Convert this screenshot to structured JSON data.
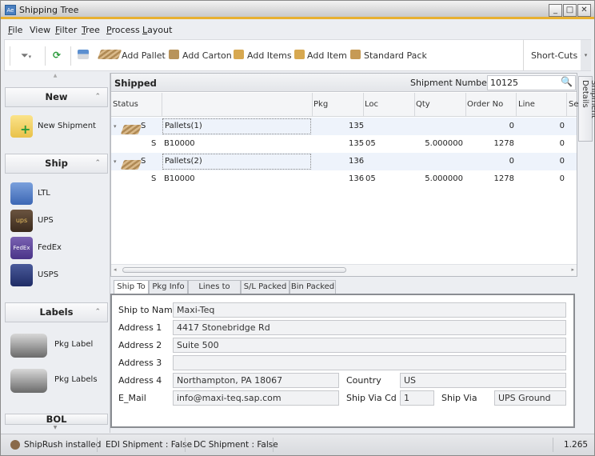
{
  "window": {
    "title": "Shipping Tree",
    "app_icon": "Ae"
  },
  "menu": [
    {
      "label": "File",
      "u": "F"
    },
    {
      "label": "View",
      "u": ""
    },
    {
      "label": "Filter",
      "u": "F"
    },
    {
      "label": "Tree",
      "u": "T"
    },
    {
      "label": "Process",
      "u": "P"
    },
    {
      "label": "Layout",
      "u": "L"
    }
  ],
  "toolbar": {
    "add_pallet": "Add Pallet",
    "add_carton": "Add Carton",
    "add_items": "Add Items",
    "add_item": "Add Item",
    "standard_pack": "Standard Pack",
    "shortcuts": "Short-Cuts"
  },
  "sidebar": {
    "groups": {
      "new": "New",
      "ship": "Ship",
      "labels": "Labels",
      "bol": "BOL"
    },
    "new_items": [
      {
        "label": "New Shipment",
        "icon": "new-shipment-icon"
      }
    ],
    "ship_items": [
      {
        "label": "LTL",
        "icon": "truck-icon"
      },
      {
        "label": "UPS",
        "icon": "ups-icon"
      },
      {
        "label": "FedEx",
        "icon": "fedex-icon"
      },
      {
        "label": "USPS",
        "icon": "usps-icon"
      }
    ],
    "label_items": [
      {
        "label": "Pkg Label",
        "icon": "printer-icon"
      },
      {
        "label": "Pkg Labels",
        "icon": "printer-icon"
      }
    ]
  },
  "grid": {
    "title": "Shipped",
    "shipment_number_label": "Shipment Number:",
    "shipment_number": "10125",
    "columns": [
      "Status",
      "",
      "Pkg",
      "Loc",
      "Qty",
      "Order No",
      "Line",
      "Se"
    ],
    "rows": [
      {
        "status": "S",
        "name": "Pallets(1)",
        "pkg": "135",
        "loc": "",
        "qty": "",
        "order": "0",
        "line": "0",
        "parent": true
      },
      {
        "status": "S",
        "name": "B10000",
        "pkg": "135",
        "loc": "05",
        "qty": "5.000000",
        "order": "1278",
        "line": "0",
        "parent": false
      },
      {
        "status": "S",
        "name": "Pallets(2)",
        "pkg": "136",
        "loc": "",
        "qty": "",
        "order": "0",
        "line": "0",
        "parent": true
      },
      {
        "status": "S",
        "name": "B10000",
        "pkg": "136",
        "loc": "05",
        "qty": "5.000000",
        "order": "1278",
        "line": "0",
        "parent": false
      }
    ]
  },
  "side_tab": "Shipment Details",
  "tabs": [
    "Ship To",
    "Pkg Info",
    "Lines to Pack",
    "S/L Packed",
    "Bin Packed"
  ],
  "ship_to": {
    "name_label": "Ship to Name",
    "name": "Maxi-Teq",
    "addr1_label": "Address 1",
    "addr1": "4417 Stonebridge Rd",
    "addr2_label": "Address 2",
    "addr2": "Suite 500",
    "addr3_label": "Address 3",
    "addr3": "",
    "addr4_label": "Address 4",
    "addr4": "Northampton, PA  18067",
    "country_label": "Country",
    "country": "US",
    "email_label": "E_Mail",
    "email": "info@maxi-teq.sap.com",
    "via_cd_label": "Ship Via Cd",
    "via_cd": "1",
    "via_label": "Ship Via",
    "via": "UPS Ground"
  },
  "status": {
    "shiprush": "ShipRush installed",
    "edi": "EDI Shipment : False",
    "dc": "DC Shipment : False",
    "version": "1.265"
  }
}
